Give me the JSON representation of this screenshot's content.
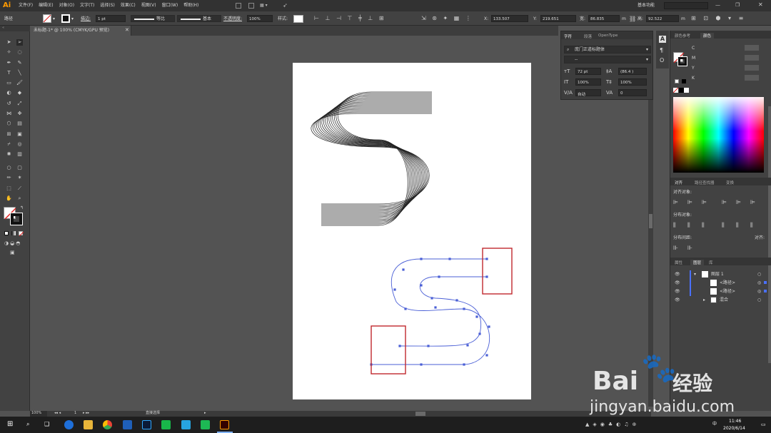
{
  "app": {
    "logo": "Ai",
    "workspace": "基本功能"
  },
  "menu": [
    "文件(F)",
    "编辑(E)",
    "对象(O)",
    "文字(T)",
    "选择(S)",
    "效果(C)",
    "视图(V)",
    "窗口(W)",
    "帮助(H)"
  ],
  "control_bar": {
    "selection_label": "路径",
    "stroke_label": "描边:",
    "stroke_value": "1 pt",
    "profile1": "等比",
    "profile2": "基本",
    "opacity_label": "不透明度:",
    "opacity_value": "100%",
    "style_label": "样式:",
    "x_value": "133.507",
    "y_value": "219.651",
    "w_value": "86.835",
    "h_value": "92.522",
    "w_unit": "m",
    "h_unit": "m"
  },
  "document_tab": {
    "title": "未标题-1* @ 100% (CMYK/GPU 预览)"
  },
  "character_panel": {
    "tabs": [
      "字符",
      "段落",
      "OpenType"
    ],
    "font_family": "庞门正道标题体",
    "font_style": "--",
    "font_size": "72 pt",
    "leading": "(86.4 )",
    "h_scale": "100%",
    "v_scale": "100%",
    "kerning": "自动",
    "tracking": "0"
  },
  "color_panel": {
    "tabs": [
      "颜色参考",
      "颜色"
    ],
    "channels": [
      "C",
      "M",
      "Y",
      "K"
    ]
  },
  "align_panel": {
    "tabs": [
      "对齐",
      "路径查找器",
      "变换"
    ],
    "align_objects": "对齐对象:",
    "distribute_objects": "分布对象:",
    "distribute_spacing": "分布间距:",
    "align_to": "对齐:"
  },
  "layers_panel": {
    "tabs": [
      "属性",
      "图层",
      "库"
    ],
    "items": [
      {
        "label": "图层 1"
      },
      {
        "label": "<路径>"
      },
      {
        "label": "<路径>"
      },
      {
        "label": "混合"
      }
    ]
  },
  "status_bar": {
    "zoom": "100%",
    "page": "1",
    "mode": "直接选择"
  },
  "taskbar": {
    "time": "11:46",
    "date": "2020/6/14",
    "ime": "中"
  },
  "watermark": {
    "brand": "Bai",
    "brand_tail": "经验",
    "url": "jingyan.baidu.com"
  },
  "colors": {
    "accent": "#ff9a00",
    "selection_blue": "#4a5fd6",
    "highlight_red": "#c0282d"
  }
}
